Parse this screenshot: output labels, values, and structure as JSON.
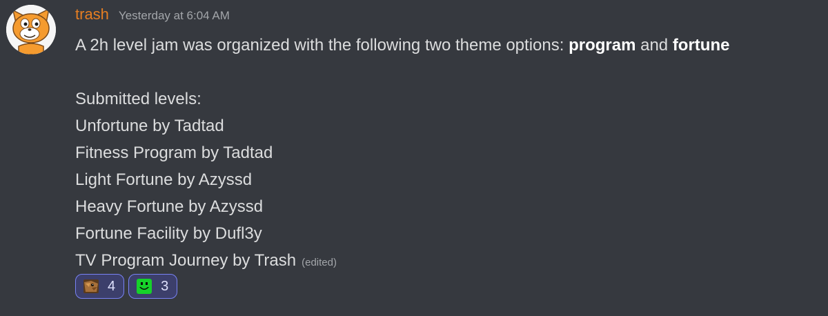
{
  "message": {
    "author": "trash",
    "timestamp": "Yesterday at 6:04 AM",
    "intro_prefix": "A 2h level jam was organized with the following two theme options: ",
    "theme_one": "program",
    "intro_and": " and ",
    "theme_two": "fortune",
    "submitted_heading": "Submitted levels:",
    "levels": [
      "Unfortune by Tadtad",
      "Fitness Program by Tadtad",
      "Light Fortune by Azyssd",
      "Heavy Fortune by Azyssd",
      "Fortune Facility by Dufl3y",
      "TV Program Journey by Trash"
    ],
    "edited_label": "(edited)",
    "author_color": "#e67e22"
  },
  "reactions": [
    {
      "icon": "bird-face-emoji-icon",
      "count": "4"
    },
    {
      "icon": "green-smiley-emoji-icon",
      "count": "3"
    }
  ]
}
